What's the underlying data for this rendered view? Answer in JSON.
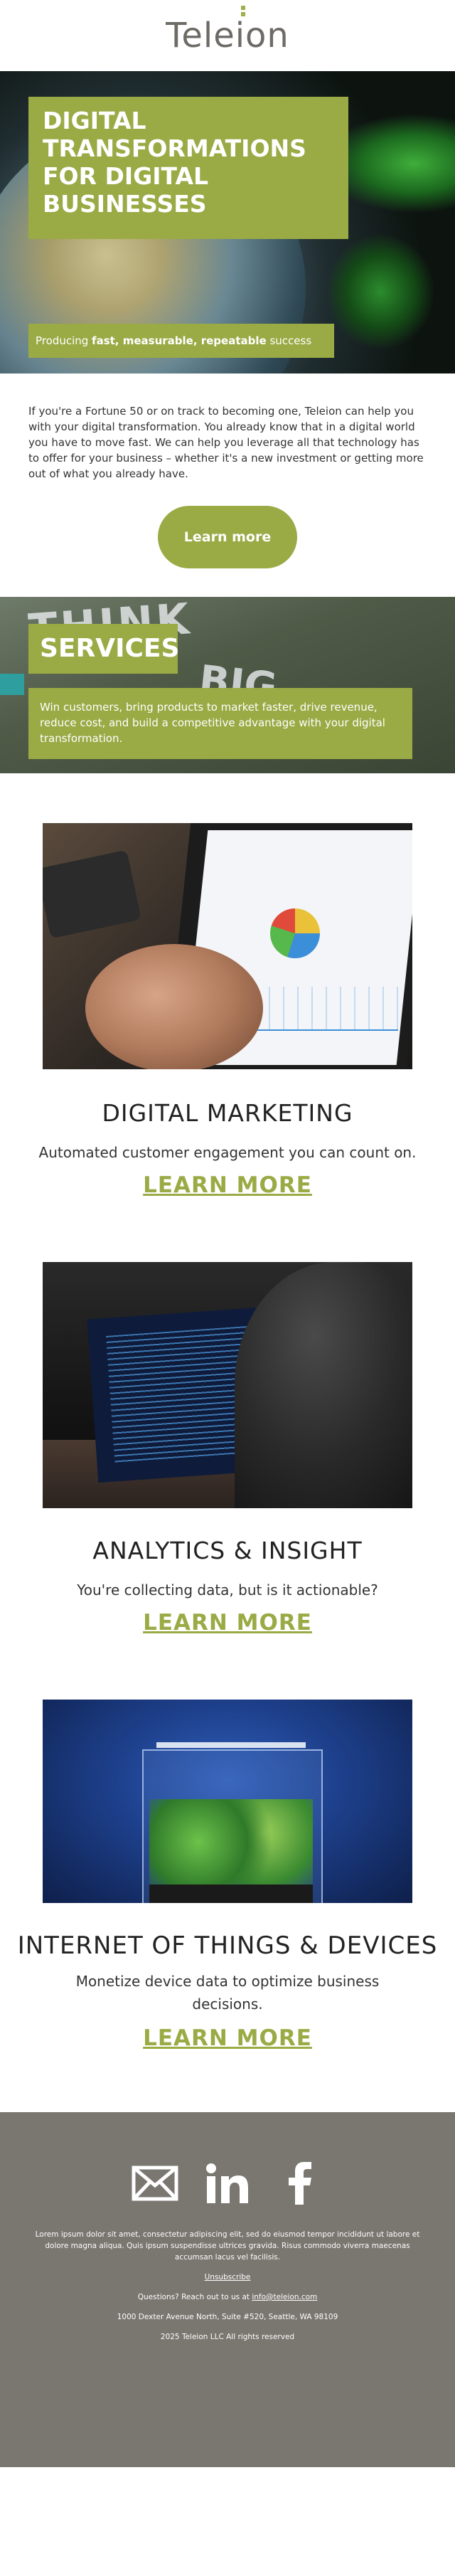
{
  "brand": {
    "logo_text": "Teleion",
    "accent": "#9aaa45",
    "footer_bg": "#7a7670"
  },
  "hero": {
    "title": "DIGITAL TRANSFORMATIONS FOR DIGITAL BUSINESSES",
    "subtitle_prefix": "Producing ",
    "subtitle_fast": "fast, measurable, repeatable",
    "subtitle_suffix": " success"
  },
  "intro": {
    "text": "If you're a Fortune 50 or on track to becoming one, Teleion can help you with your digital transformation. You already know that in a digital world you have to move fast. We can help you leverage all that technology has to offer for your business – whether it's a new investment or getting more out of what you already have.",
    "button_label": "Learn more"
  },
  "services": {
    "title": "SERVICES",
    "description": "Win customers, bring products to market faster, drive revenue, reduce cost, and build a competitive advantage with your digital transformation."
  },
  "features": [
    {
      "title": "DIGITAL MARKETING",
      "description": "Automated customer engagement you can count on.",
      "link": "LEARN MORE"
    },
    {
      "title": "ANALYTICS & INSIGHT",
      "description": "You're collecting data, but is it actionable?",
      "link": "LEARN MORE"
    },
    {
      "title": "INTERNET OF THINGS & DEVICES",
      "description": "Monetize device data to optimize business decisions.",
      "link": "LEARN MORE"
    }
  ],
  "footer": {
    "icons": [
      "mail-icon",
      "linkedin-icon",
      "facebook-icon"
    ],
    "lorem": "Lorem ipsum dolor sit amet, consectetur adipiscing elit, sed do eiusmod tempor incididunt ut labore et dolore magna aliqua. Quis ipsum suspendisse ultrices gravida. Risus commodo viverra maecenas accumsan lacus vel facilisis.",
    "unsubscribe": "Unsubscribe",
    "questions_prefix": "Questions? Reach out to us at ",
    "email": "info@teleion.com",
    "address": "1000 Dexter Avenue North, Suite #520, Seattle, WA 98109",
    "copyright": "2025 Teleion LLC All rights reserved"
  }
}
